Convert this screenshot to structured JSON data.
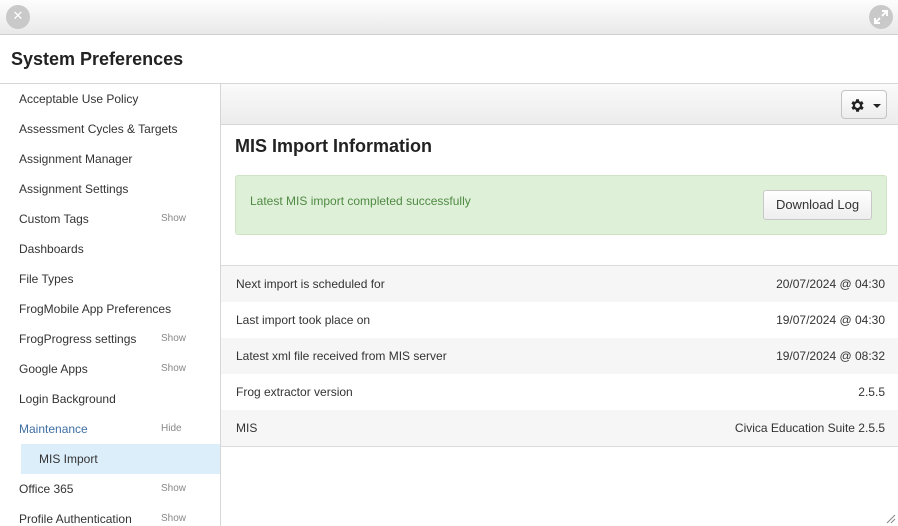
{
  "window": {
    "title": "System Preferences"
  },
  "sidebar": {
    "items": [
      {
        "label": "Acceptable Use Policy",
        "toggle": ""
      },
      {
        "label": "Assessment Cycles & Targets",
        "toggle": ""
      },
      {
        "label": "Assignment Manager",
        "toggle": ""
      },
      {
        "label": "Assignment Settings",
        "toggle": ""
      },
      {
        "label": "Custom Tags",
        "toggle": "Show"
      },
      {
        "label": "Dashboards",
        "toggle": ""
      },
      {
        "label": "File Types",
        "toggle": ""
      },
      {
        "label": "FrogMobile App Preferences",
        "toggle": ""
      },
      {
        "label": "FrogProgress settings",
        "toggle": "Show"
      },
      {
        "label": "Google Apps",
        "toggle": "Show"
      },
      {
        "label": "Login Background",
        "toggle": ""
      },
      {
        "label": "Maintenance",
        "toggle": "Hide"
      },
      {
        "label": "MIS Import",
        "toggle": ""
      },
      {
        "label": "Office 365",
        "toggle": "Show"
      },
      {
        "label": "Profile Authentication",
        "toggle": "Show"
      }
    ]
  },
  "main": {
    "title": "MIS Import Information",
    "alert": {
      "message": "Latest MIS import completed successfully",
      "button": "Download Log"
    },
    "info": [
      {
        "label": "Next import is scheduled for",
        "value": "20/07/2024 @ 04:30"
      },
      {
        "label": "Last import took place on",
        "value": "19/07/2024 @ 04:30"
      },
      {
        "label": "Latest xml file received from MIS server",
        "value": "19/07/2024 @ 08:32"
      },
      {
        "label": "Frog extractor version",
        "value": "2.5.5"
      },
      {
        "label": "MIS",
        "value": "Civica Education Suite 2.5.5"
      }
    ]
  },
  "icons": {
    "close": "close-icon",
    "expand": "expand-icon",
    "settings": "gear-icon",
    "resize": "resize-grip-icon"
  },
  "colors": {
    "success_bg": "#dff0d8",
    "success_text": "#4f8a43",
    "link": "#3f6fa3",
    "selected_bg": "#ddeefb"
  }
}
